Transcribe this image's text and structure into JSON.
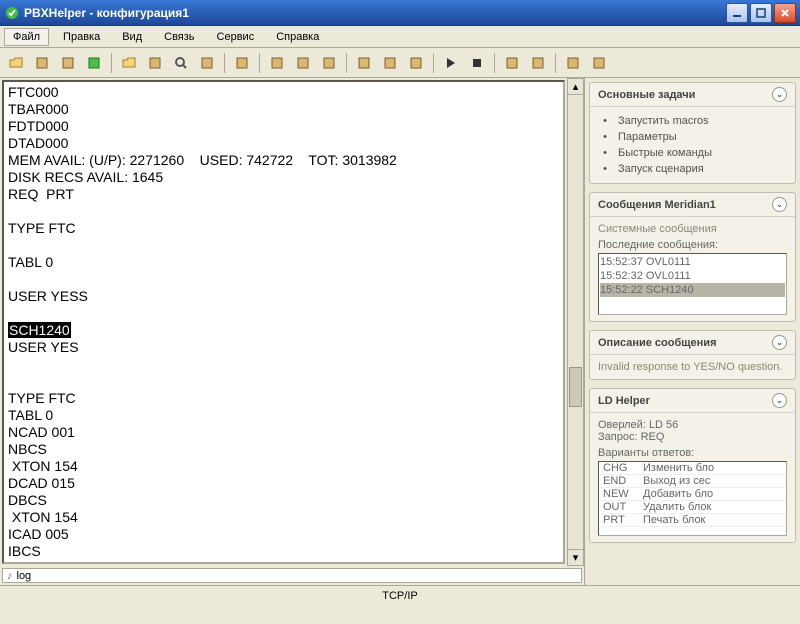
{
  "window": {
    "title": "PBXHelper - конфигурация1"
  },
  "menu": {
    "items": [
      "Файл",
      "Правка",
      "Вид",
      "Связь",
      "Сервис",
      "Справка"
    ]
  },
  "toolbar_icons": [
    "open-file-icon",
    "properties-icon",
    "connect-icon",
    "disconnect-icon",
    "sep",
    "folder-icon",
    "copy-icon",
    "find-icon",
    "refresh-icon",
    "sep",
    "script-icon",
    "sep",
    "doc1-icon",
    "doc2-icon",
    "doc3-icon",
    "sep",
    "book1-icon",
    "book2-icon",
    "book3-icon",
    "sep",
    "play-icon",
    "stop-icon",
    "sep",
    "tool1-icon",
    "tool2-icon",
    "sep",
    "help1-icon",
    "help2-icon"
  ],
  "terminal": {
    "lines": [
      "FTC000",
      "TBAR000",
      "FDTD000",
      "DTAD000",
      "MEM AVAIL: (U/P): 2271260    USED: 742722    TOT: 3013982",
      "DISK RECS AVAIL: 1645",
      "REQ  PRT",
      "",
      "TYPE FTC",
      "",
      "TABL 0",
      "",
      "USER YESS",
      ""
    ],
    "highlight": "SCH1240",
    "lines_after": [
      "USER YES",
      "",
      "",
      "TYPE FTC",
      "TABL 0",
      "NCAD 001",
      "NBCS",
      " XTON 154",
      "DCAD 015",
      "DBCS",
      " XTON 154",
      "ICAD 005",
      "IBCS"
    ]
  },
  "side": {
    "tasks": {
      "title": "Основные задачи",
      "items": [
        {
          "icon": "wand-icon",
          "label": "Запустить macros"
        },
        {
          "icon": "tools-icon",
          "label": "Параметры"
        },
        {
          "icon": "gear-icon",
          "label": "Быстрые команды"
        },
        {
          "icon": "play-icon",
          "label": "Запуск сценария"
        }
      ]
    },
    "messages": {
      "title": "Сообщения Meridian1",
      "subtitle": "Системные сообщения",
      "recent_label": "Последние сообщения:",
      "items": [
        {
          "time": "15:52:37",
          "code": "OVL0111",
          "sel": false
        },
        {
          "time": "15:52:32",
          "code": "OVL0111",
          "sel": false
        },
        {
          "time": "15:52:22",
          "code": "SCH1240",
          "sel": true
        }
      ]
    },
    "desc": {
      "title": "Описание сообщения",
      "text": "Invalid response to YES/NO question."
    },
    "ldhelper": {
      "title": "LD Helper",
      "overlay_label": "Оверлей:",
      "overlay_value": "LD 56",
      "request_label": "Запрос:",
      "request_value": "REQ",
      "variants_label": "Варианты ответов:",
      "rows": [
        {
          "cmd": "CHG",
          "desc": "Изменить бло"
        },
        {
          "cmd": "END",
          "desc": "Выход из сес"
        },
        {
          "cmd": "NEW",
          "desc": "Добавить бло"
        },
        {
          "cmd": "OUT",
          "desc": "Удалить блок"
        },
        {
          "cmd": "PRT",
          "desc": "Печать блок"
        }
      ]
    }
  },
  "input": {
    "prompt_icon": "prompt-icon",
    "text": "log"
  },
  "status": {
    "text": "TCP/IP"
  }
}
